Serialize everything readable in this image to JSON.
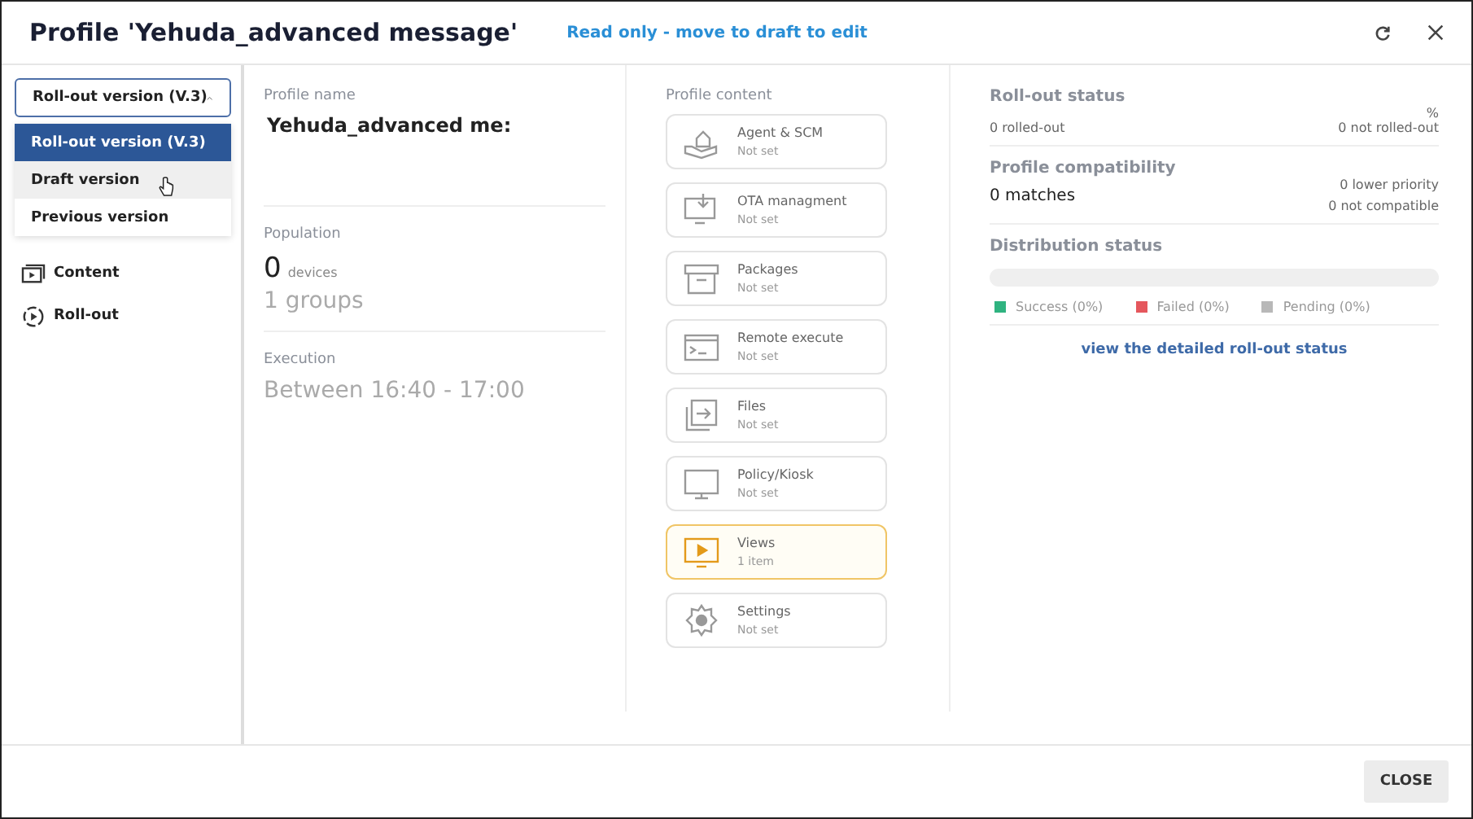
{
  "header": {
    "title": "Profile 'Yehuda_advanced message'",
    "notice": "Read only - move to draft to edit"
  },
  "version_select": {
    "value": "Roll-out version (V.3)",
    "expanded": true,
    "options": [
      {
        "label": "Roll-out version (V.3)",
        "selected": true,
        "hovered": false
      },
      {
        "label": "Draft version",
        "selected": false,
        "hovered": true
      },
      {
        "label": "Previous version",
        "selected": false,
        "hovered": false
      }
    ]
  },
  "nav": [
    {
      "label": "Content"
    },
    {
      "label": "Roll-out"
    }
  ],
  "profile": {
    "name_label": "Profile name",
    "name": "Yehuda_advanced me:",
    "population_label": "Population",
    "devices_count": "0",
    "devices_unit": "devices",
    "groups": "1 groups",
    "execution_label": "Execution",
    "execution": "Between 16:40 - 17:00"
  },
  "content": {
    "title": "Profile content",
    "items": [
      {
        "name": "Agent & SCM",
        "status": "Not set",
        "active": false
      },
      {
        "name": "OTA managment",
        "status": "Not set",
        "active": false
      },
      {
        "name": "Packages",
        "status": "Not set",
        "active": false
      },
      {
        "name": "Remote execute",
        "status": "Not set",
        "active": false
      },
      {
        "name": "Files",
        "status": "Not set",
        "active": false
      },
      {
        "name": "Policy/Kiosk",
        "status": "Not set",
        "active": false
      },
      {
        "name": "Views",
        "status": "1 item",
        "active": true
      },
      {
        "name": "Settings",
        "status": "Not set",
        "active": false
      }
    ]
  },
  "rollout_status": {
    "title": "Roll-out status",
    "percent": "%",
    "rolled_out": "0 rolled-out",
    "not_rolled_out": "0 not rolled-out"
  },
  "compatibility": {
    "title": "Profile compatibility",
    "matches": "0 matches",
    "lower_priority": "0 lower priority",
    "not_compatible": "0 not compatible"
  },
  "distribution": {
    "title": "Distribution status",
    "legend": [
      {
        "label": "Success (0%)",
        "color": "#2fb380"
      },
      {
        "label": "Failed (0%)",
        "color": "#e5575d"
      },
      {
        "label": "Pending (0%)",
        "color": "#b8b8b8"
      }
    ],
    "link": "view the detailed roll-out status"
  },
  "footer": {
    "close": "CLOSE"
  }
}
